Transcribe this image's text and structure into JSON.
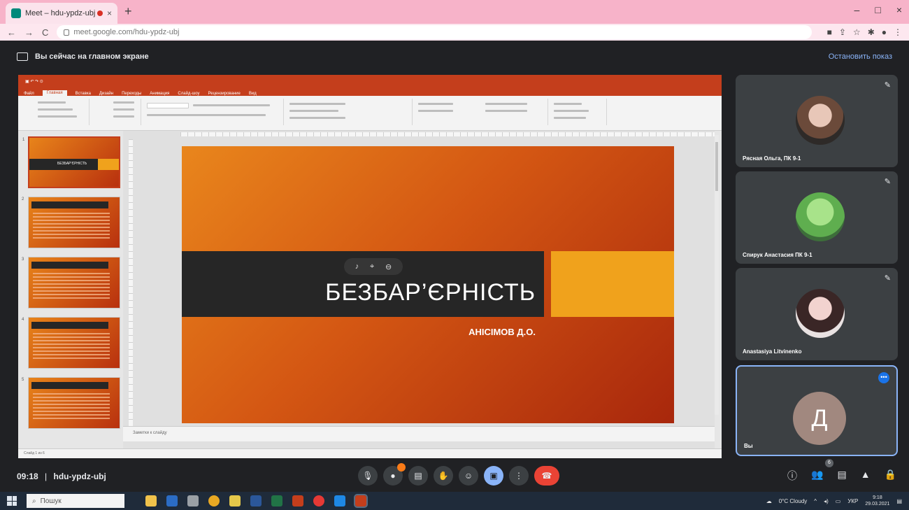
{
  "browser": {
    "tab_title": "Meet – hdu-ypdz-ubj",
    "tab_close": "×",
    "new_tab": "+",
    "url": "meet.google.com/hdu-ypdz-ubj",
    "nav": {
      "back": "←",
      "forward": "→",
      "reload": "C"
    },
    "window_controls": {
      "minimize": "–",
      "maximize": "□",
      "close": "×"
    }
  },
  "presenting": {
    "message": "Вы сейчас на главном экране",
    "stop_label": "Остановить показ"
  },
  "powerpoint": {
    "tabs": [
      "Файл",
      "Главная",
      "Вставка",
      "Дизайн",
      "Переходы",
      "Анимация",
      "Слайд-шоу",
      "Рецензирование",
      "Вид"
    ],
    "active_tab": "Главная",
    "notes_label": "Заметки к слайду",
    "status": "Слайд 1 из 6",
    "slide": {
      "title": "БЕЗБАР’ЄРНІСТЬ",
      "subtitle": "АНІСІМОВ Д.О."
    },
    "thumbnails": [
      {
        "num": "1",
        "label": "БЕЗБАР’ЄРНІСТЬ"
      },
      {
        "num": "2",
        "label": ""
      },
      {
        "num": "3",
        "label": ""
      },
      {
        "num": "4",
        "label": ""
      },
      {
        "num": "5",
        "label": ""
      }
    ]
  },
  "participants": [
    {
      "name": "Рясная Ольга, ПК 9-1"
    },
    {
      "name": "Спирук Анастасия ПК 9-1"
    },
    {
      "name": "Anastasiya Litvinenko"
    }
  ],
  "self_tile": {
    "initial": "Д",
    "name": "Вы"
  },
  "meeting": {
    "time": "09:18",
    "code": "hdu-ypdz-ubj",
    "separator": "|",
    "people_count": "6"
  },
  "taskbar": {
    "search_placeholder": "Пошук",
    "weather": "0°C Cloudy",
    "language": "УКР",
    "time": "9:18",
    "date": "29.03.2021"
  },
  "colors": {
    "ppt_accent": "#c43e1c",
    "slide_gold": "#f0a21c",
    "meet_bg": "#202124",
    "end_call": "#ea4335",
    "present_blue": "#8ab4f8",
    "tab_strip": "#f7b3c9"
  },
  "icons": {
    "mic": "mic-icon",
    "camera": "camera-icon",
    "captions": "captions-icon",
    "raise_hand": "hand-icon",
    "emoji": "emoji-icon",
    "present": "present-icon",
    "more": "more-vert-icon",
    "end_call": "end-call-icon",
    "info": "info-icon",
    "people": "people-icon",
    "chat": "chat-icon",
    "activities": "activities-icon",
    "lock": "lock-icon"
  }
}
